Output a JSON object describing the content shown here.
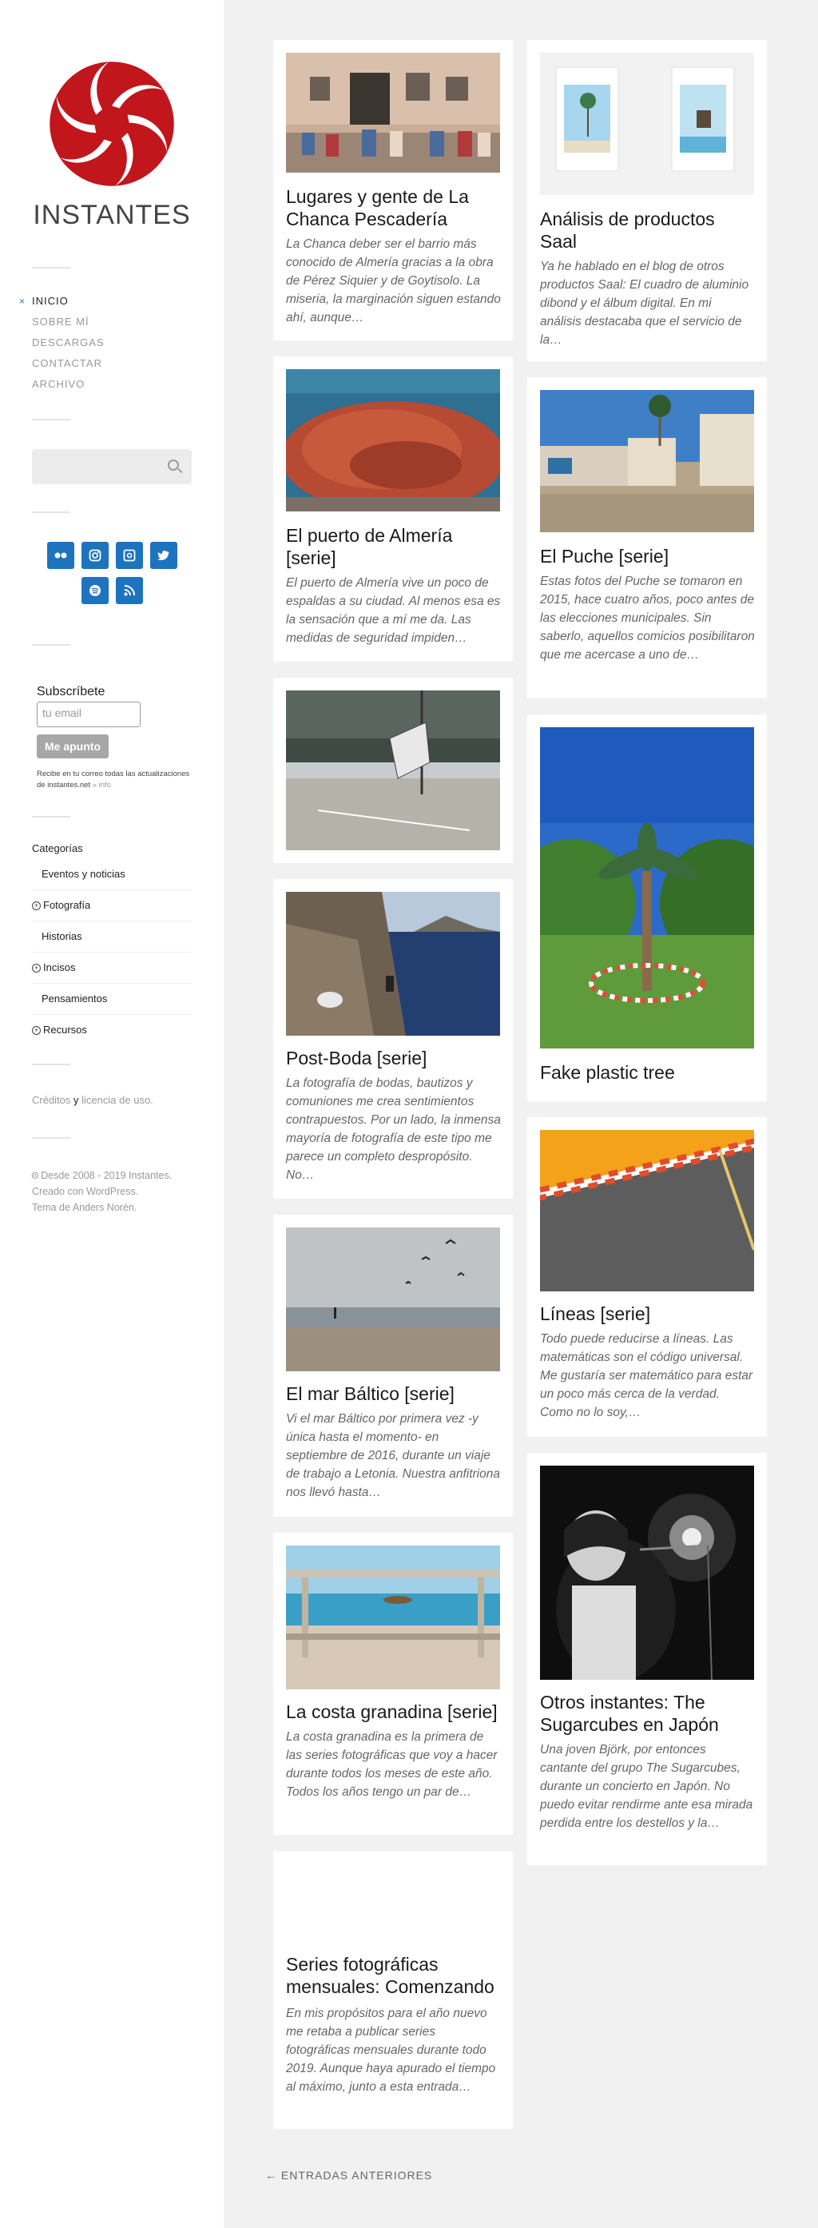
{
  "site": {
    "title": "INSTANTES"
  },
  "nav": [
    {
      "label": "INICIO",
      "active": true
    },
    {
      "label": "SOBRE MÍ",
      "active": false
    },
    {
      "label": "DESCARGAS",
      "active": false
    },
    {
      "label": "CONTACTAR",
      "active": false
    },
    {
      "label": "ARCHIVO",
      "active": false
    }
  ],
  "nav_active_marker": "×",
  "social": [
    "flickr-icon",
    "instagram-icon",
    "500px-icon",
    "twitter-icon",
    "spotify-icon",
    "rss-icon"
  ],
  "subscribe": {
    "title": "Subscríbete",
    "placeholder": "tu email",
    "button": "Me apunto",
    "note": "Recibe en tu correo todas las actualizaciones de instantes.net",
    "info_link": "» info"
  },
  "categories": {
    "title": "Categorías",
    "items": [
      {
        "label": "Eventos y noticias",
        "expandable": false
      },
      {
        "label": "Fotografía",
        "expandable": true
      },
      {
        "label": "Historias",
        "expandable": false
      },
      {
        "label": "Incisos",
        "expandable": true
      },
      {
        "label": "Pensamientos",
        "expandable": false
      },
      {
        "label": "Recursos",
        "expandable": true
      }
    ]
  },
  "credits": {
    "creditos": "Créditos",
    "y": "y",
    "licencia": "licencia de uso",
    "end": "."
  },
  "copyright": {
    "line1": "Desde 2008 - 2019 Instantes.",
    "line2": "Creado con WordPress.",
    "line3": "Tema de Anders Norén."
  },
  "posts": [
    {
      "title": "Lugares y gente de La Chanca Pescadería",
      "excerpt": "La Chanca deber ser el barrio más conocido de Almería gracias a la obra de Pérez Siquier y de Goytisolo. La miseria, la marginación siguen estando ahí, aunque…"
    },
    {
      "title": "El puerto de Almería [serie]",
      "excerpt": "El puerto de Almería vive un poco de espaldas a su ciudad. Al menos esa es la sensación que a mí me da. Las medidas de seguridad impiden…"
    },
    {
      "title": "",
      "excerpt": ""
    },
    {
      "title": "Post-Boda [serie]",
      "excerpt": "La fotografía de bodas, bautizos y comuniones me crea sentimientos contrapuestos. Por un lado,  la inmensa mayoría de fotografía de este tipo me parece un completo despropósito. No…"
    },
    {
      "title": "El mar Báltico [serie]",
      "excerpt": "Vi el mar Báltico por primera vez -y única hasta el momento- en septiembre de 2016, durante un viaje de trabajo a Letonia. Nuestra anfitriona nos llevó hasta…"
    },
    {
      "title": "La costa granadina [serie]",
      "excerpt": "La costa granadina es la primera de las series fotográficas que voy a hacer durante todos los meses de este año. Todos los años tengo un par de…"
    },
    {
      "title": "Series fotográficas mensuales: Comenzando",
      "excerpt": "En mis propósitos para el año nuevo me retaba a publicar series fotográficas mensuales durante todo 2019. Aunque haya apurado el tiempo al máximo, junto a esta entrada…"
    },
    {
      "title": "Análisis de productos Saal",
      "excerpt": "Ya he hablado en el blog de otros productos Saal: El cuadro de aluminio dibond y el álbum digital. En mi análisis destacaba que el servicio de la…"
    },
    {
      "title": "El Puche [serie]",
      "excerpt": "Estas fotos del Puche se tomaron en 2015, hace cuatro años, poco antes de las elecciones municipales. Sin saberlo, aquellos comicios posibilitaron que me acercase a uno de…"
    },
    {
      "title": "Fake plastic tree",
      "excerpt": ""
    },
    {
      "title": "Líneas [serie]",
      "excerpt": "Todo puede reducirse a líneas. Las matemáticas son el código universal. Me gustaría ser matemático para estar un poco más cerca de la verdad. Como no lo soy,…"
    },
    {
      "title": "Otros instantes: The Sugarcubes en Japón",
      "excerpt": "Una joven Björk, por entonces cantante del grupo  The Sugarcubes, durante un concierto en Japón. No puedo evitar rendirme ante esa mirada perdida entre los destellos y la…"
    }
  ],
  "pagination": {
    "older": "← ENTRADAS ANTERIORES"
  },
  "colors": {
    "accent": "#1e73be",
    "logo": "#c0161c",
    "background": "#f1f1f1"
  }
}
